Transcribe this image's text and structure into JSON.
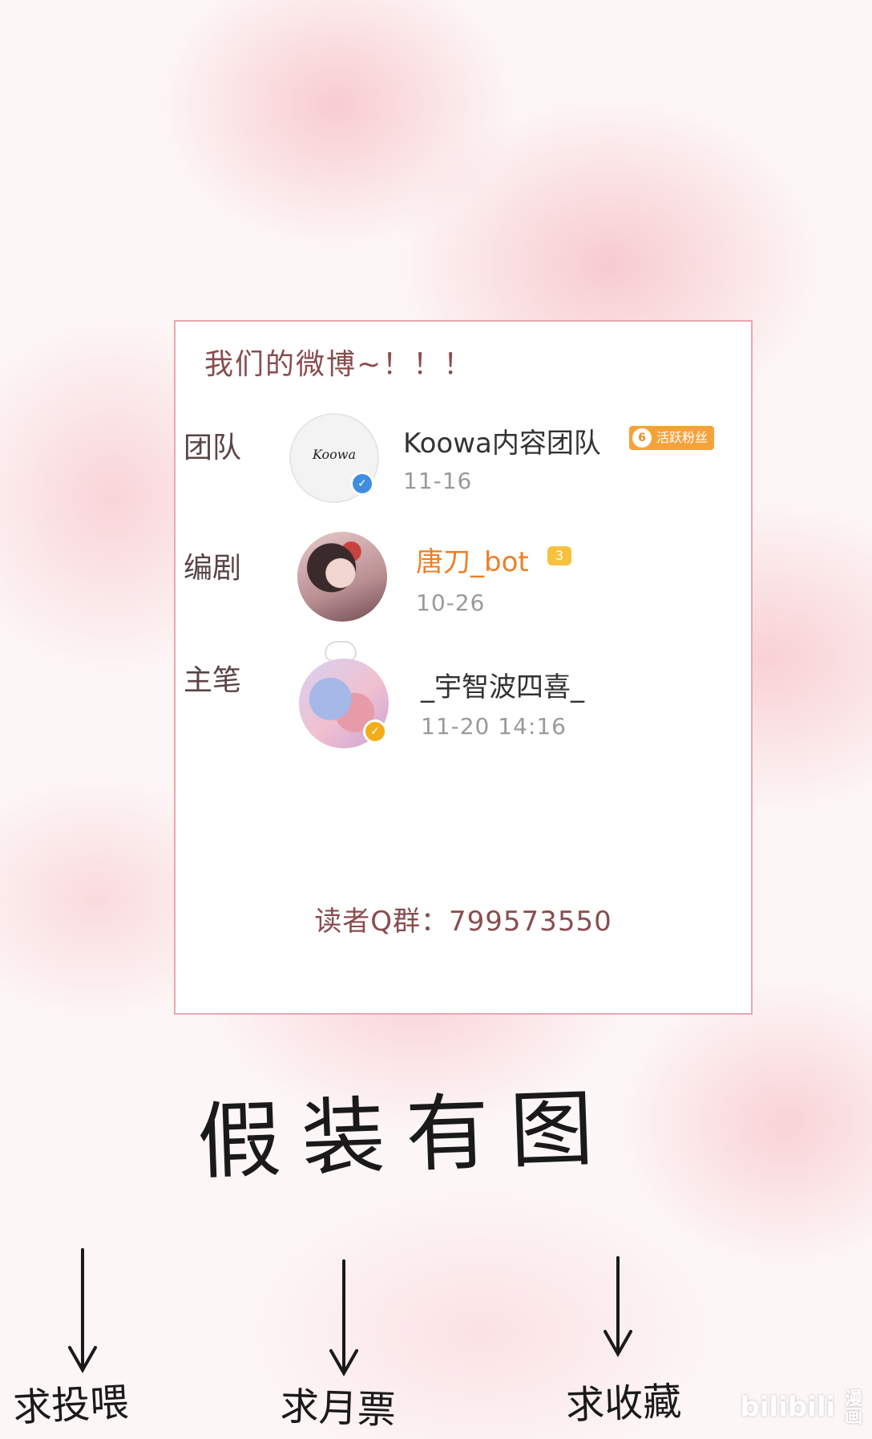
{
  "card": {
    "title": "我们的微博~！！！",
    "rows": [
      {
        "label": "团队",
        "name": "Koowa内容团队",
        "badge_level": "6",
        "badge_text": "活跃粉丝",
        "date": "11-16",
        "avatar_text": "Koowa",
        "verify_icon": "blue-v-icon"
      },
      {
        "label": "编剧",
        "name": "唐刀_bot",
        "crown_text": "3",
        "date": "10-26",
        "verify_icon": "crown-icon"
      },
      {
        "label": "主笔",
        "name": "_宇智波四喜_",
        "date": "11-20 14:16",
        "verify_icon": "gold-v-icon"
      }
    ],
    "qq_group": "读者Q群：799573550"
  },
  "handwritten": {
    "headline": "假装有图",
    "labels": [
      "求投喂",
      "求月票",
      "求收藏"
    ]
  },
  "watermark": {
    "text": "bilibili",
    "suffix": "漫画"
  },
  "colors": {
    "card_border": "#e8a8ad",
    "title_text": "#8a4c4e",
    "orange_name": "#ee7f26",
    "badge_orange": "#f6a23a",
    "verify_blue": "#3f8fe0",
    "verify_gold": "#f4ad1a"
  }
}
